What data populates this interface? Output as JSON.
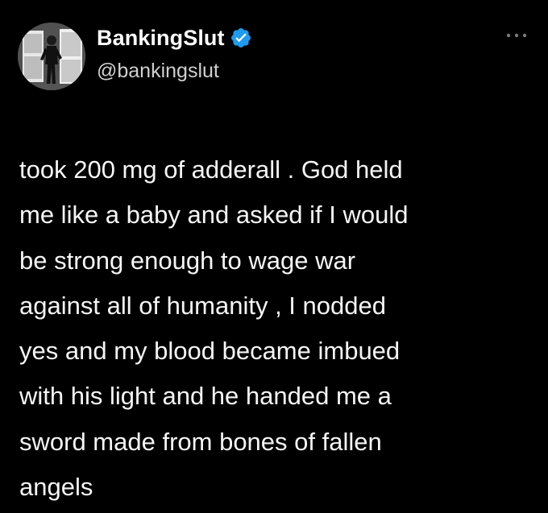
{
  "author": {
    "display_name": "BankingSlut",
    "handle": "@bankingslut",
    "verified": true,
    "verified_color": "#1d9bf0"
  },
  "tweet": {
    "text": "took 200 mg of adderall . God held\nme like a baby and asked if I would\nbe strong enough to wage war\nagainst all of humanity , I nodded\nyes and my blood became imbued\nwith his light and he handed me a\nsword made from bones of fallen\nangels"
  },
  "icons": {
    "avatar": "profile-photo",
    "verified": "verified-badge-icon",
    "more": "more-options-icon"
  },
  "colors": {
    "background": "#000000",
    "text": "#ffffff",
    "secondary_text": "#cfcfcf"
  }
}
